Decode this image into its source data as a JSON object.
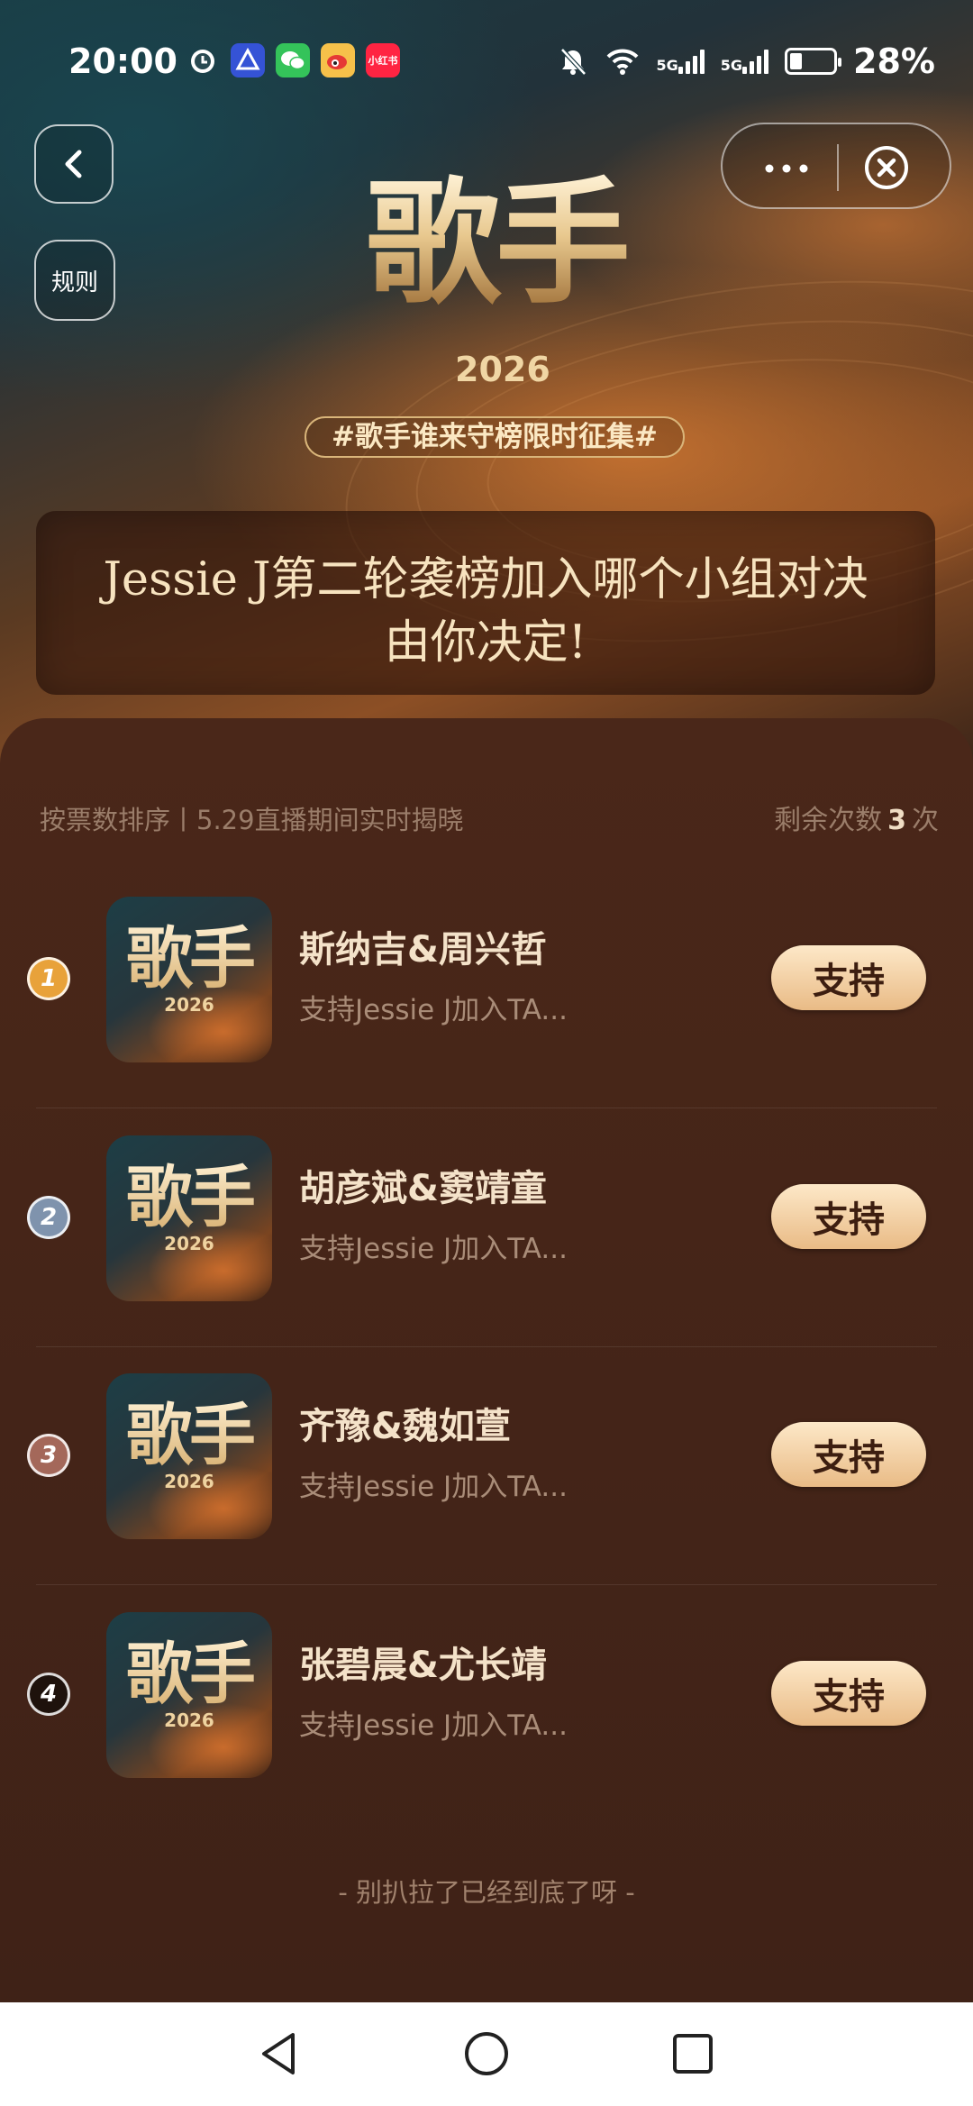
{
  "status_bar": {
    "time": "20:00",
    "app_icons": [
      "alarm-icon",
      "blue-app-icon",
      "wechat-icon",
      "weibo-icon",
      "xiaohongshu-icon"
    ],
    "xiaohongshu_label": "小红书",
    "network_1": "5G",
    "network_2": "5G",
    "battery_percent": "28%",
    "battery_level": 0.28
  },
  "header": {
    "rules_label": "规则",
    "logo_title": "歌手",
    "logo_year": "2026",
    "hashtag": "#歌手谁来守榜限时征集#"
  },
  "banner": {
    "line1": "Jessie J第二轮袭榜加入哪个小组对决",
    "line2": "由你决定!"
  },
  "panel": {
    "sort_text": "按票数排序丨5.29直播期间实时揭晓",
    "remaining_prefix": "剩余次数",
    "remaining_count": "3",
    "remaining_suffix": "次"
  },
  "candidates": [
    {
      "rank": "1",
      "rank_color": "#e8a23a",
      "name": "斯纳吉&周兴哲",
      "desc": "支持Jessie J加入TA...",
      "button": "支持",
      "thumb_title": "歌手",
      "thumb_year": "2026"
    },
    {
      "rank": "2",
      "rank_color": "#7f93ad",
      "name": "胡彦斌&窦靖童",
      "desc": "支持Jessie J加入TA...",
      "button": "支持",
      "thumb_title": "歌手",
      "thumb_year": "2026"
    },
    {
      "rank": "3",
      "rank_color": "#a4685a",
      "name": "齐豫&魏如萱",
      "desc": "支持Jessie J加入TA...",
      "button": "支持",
      "thumb_title": "歌手",
      "thumb_year": "2026"
    },
    {
      "rank": "4",
      "rank_color": "#1e120c",
      "name": "张碧晨&尤长靖",
      "desc": "支持Jessie J加入TA...",
      "button": "支持",
      "thumb_title": "歌手",
      "thumb_year": "2026"
    }
  ],
  "footer_note": "- 别扒拉了已经到底了呀 -",
  "colors": {
    "panel_bg": "#4a2719",
    "button_bg": "#f3cfa0",
    "text_light": "#f4e2c9"
  }
}
